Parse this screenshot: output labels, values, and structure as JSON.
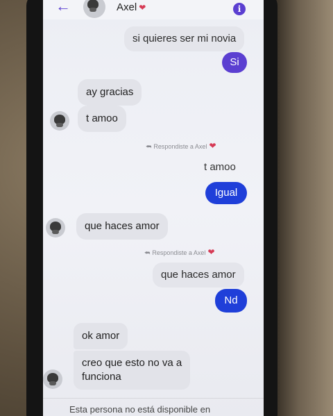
{
  "header": {
    "contact_name": "Axel",
    "back_icon": "arrow-left-icon",
    "info_icon": "info-icon"
  },
  "colors": {
    "accent_purple": "#5b3fd1",
    "accent_blue": "#1f3fd9",
    "heart": "#d63a55"
  },
  "messages": {
    "m1": "si quieres ser mi novia",
    "m2": "Si",
    "m3": "ay gracias",
    "m4": "t amoo",
    "reply1": "Respondiste a Axel",
    "m5": "t amoo",
    "m6": "Igual",
    "m7": "que haces amor",
    "reply2": "Respondiste a Axel",
    "m8": "que haces amor",
    "m9": "Nd",
    "m10": "ok amor",
    "m11_line1": "creo que esto no va a",
    "m11_line2": "funciona"
  },
  "footer": {
    "notice": "Esta persona no está disponible en"
  }
}
